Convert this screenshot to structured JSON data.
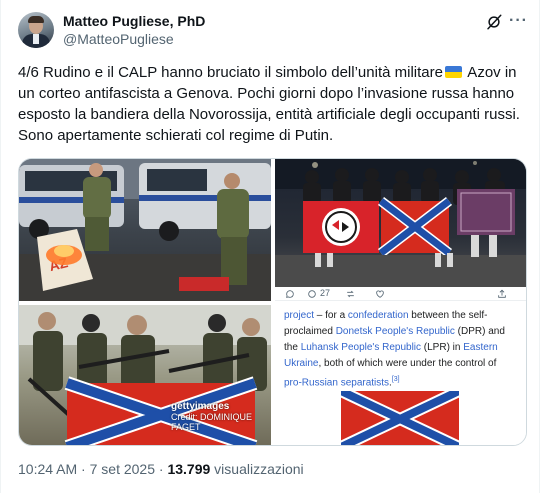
{
  "author": {
    "name": "Matteo Pugliese, PhD",
    "handle": "@MatteoPugliese"
  },
  "tweet": {
    "text_part1": "4/6 Rudino e il CALP hanno bruciato il simbolo dell’unità militare",
    "text_part2": " Azov in un corteo antifascista a Genova. Pochi giorni dopo l’invasione russa hanno esposto la bandiera della Novorossija, entità artificiale degli occupanti russi. Sono apertamente schierati col regime di Putin."
  },
  "media": {
    "getty_logo": "gettyimages",
    "getty_credit": "Credit: DOMINIQUE FAGET",
    "wiki_bar": {
      "reply_count": "",
      "retweet_count": "27"
    },
    "wiki_lines": [
      {
        "parts": [
          {
            "t": "project",
            "link": true
          },
          {
            "t": " – for a ",
            "link": false
          },
          {
            "t": "confederation",
            "link": true
          },
          {
            "t": " between the self-",
            "link": false
          }
        ]
      },
      {
        "parts": [
          {
            "t": "proclaimed ",
            "link": false
          },
          {
            "t": "Donetsk People's Republic",
            "link": true
          },
          {
            "t": " (DPR) and",
            "link": false
          }
        ]
      },
      {
        "parts": [
          {
            "t": "the ",
            "link": false
          },
          {
            "t": "Luhansk People's Republic",
            "link": true
          },
          {
            "t": " (LPR) in ",
            "link": false
          },
          {
            "t": "Eastern",
            "link": true
          }
        ]
      },
      {
        "parts": [
          {
            "t": "Ukraine",
            "link": true
          },
          {
            "t": ", both of which were under the control of",
            "link": false
          }
        ]
      },
      {
        "parts": [
          {
            "t": "pro-Russian separatists",
            "link": true
          },
          {
            "t": ".",
            "link": false
          },
          {
            "t": "[3]",
            "link": true,
            "sup": true
          }
        ]
      }
    ]
  },
  "footer": {
    "time": "10:24 AM",
    "separator": " · ",
    "date": "7 set 2025",
    "dot": " · ",
    "views_count": "13.799",
    "views_label": " visualizzazioni"
  },
  "colors": {
    "text": "#0f1419",
    "secondary": "#536471",
    "link": "#3366cc",
    "novorossiya_red": "#d52b1e",
    "novorossiya_blue": "#1e4fa8"
  }
}
